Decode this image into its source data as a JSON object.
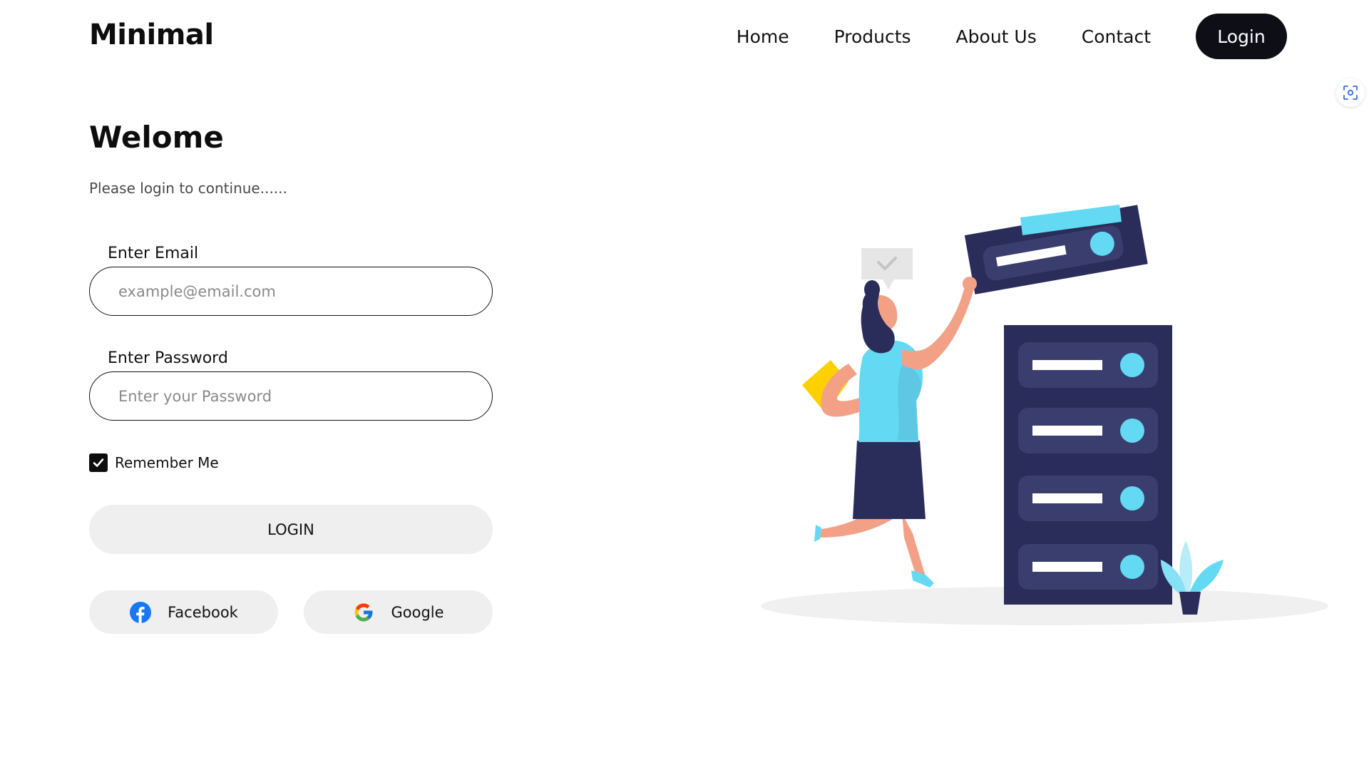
{
  "header": {
    "logo": "Minimal",
    "nav": [
      {
        "label": "Home"
      },
      {
        "label": "Products"
      },
      {
        "label": "About Us"
      },
      {
        "label": "Contact"
      }
    ],
    "login_button": "Login"
  },
  "form": {
    "title": "Welome",
    "subtitle": "Please login to continue......",
    "email": {
      "label": "Enter Email",
      "placeholder": "example@email.com",
      "value": ""
    },
    "password": {
      "label": "Enter Password",
      "placeholder": "Enter your Password",
      "value": ""
    },
    "remember": {
      "label": "Remember Me",
      "checked": true
    },
    "submit_label": "LOGIN",
    "social": {
      "facebook": "Facebook",
      "google": "Google"
    }
  },
  "colors": {
    "primary_dark": "#0e0e16",
    "button_bg": "#efefef",
    "illustration_navy": "#2a2d5a",
    "illustration_cyan": "#63d9f4",
    "illustration_yellow": "#fdd000",
    "illustration_skin": "#f2a187",
    "facebook_blue": "#1877f2"
  },
  "icons": {
    "scan": "scan-icon",
    "check": "check-icon",
    "facebook": "facebook-icon",
    "google": "google-icon"
  }
}
